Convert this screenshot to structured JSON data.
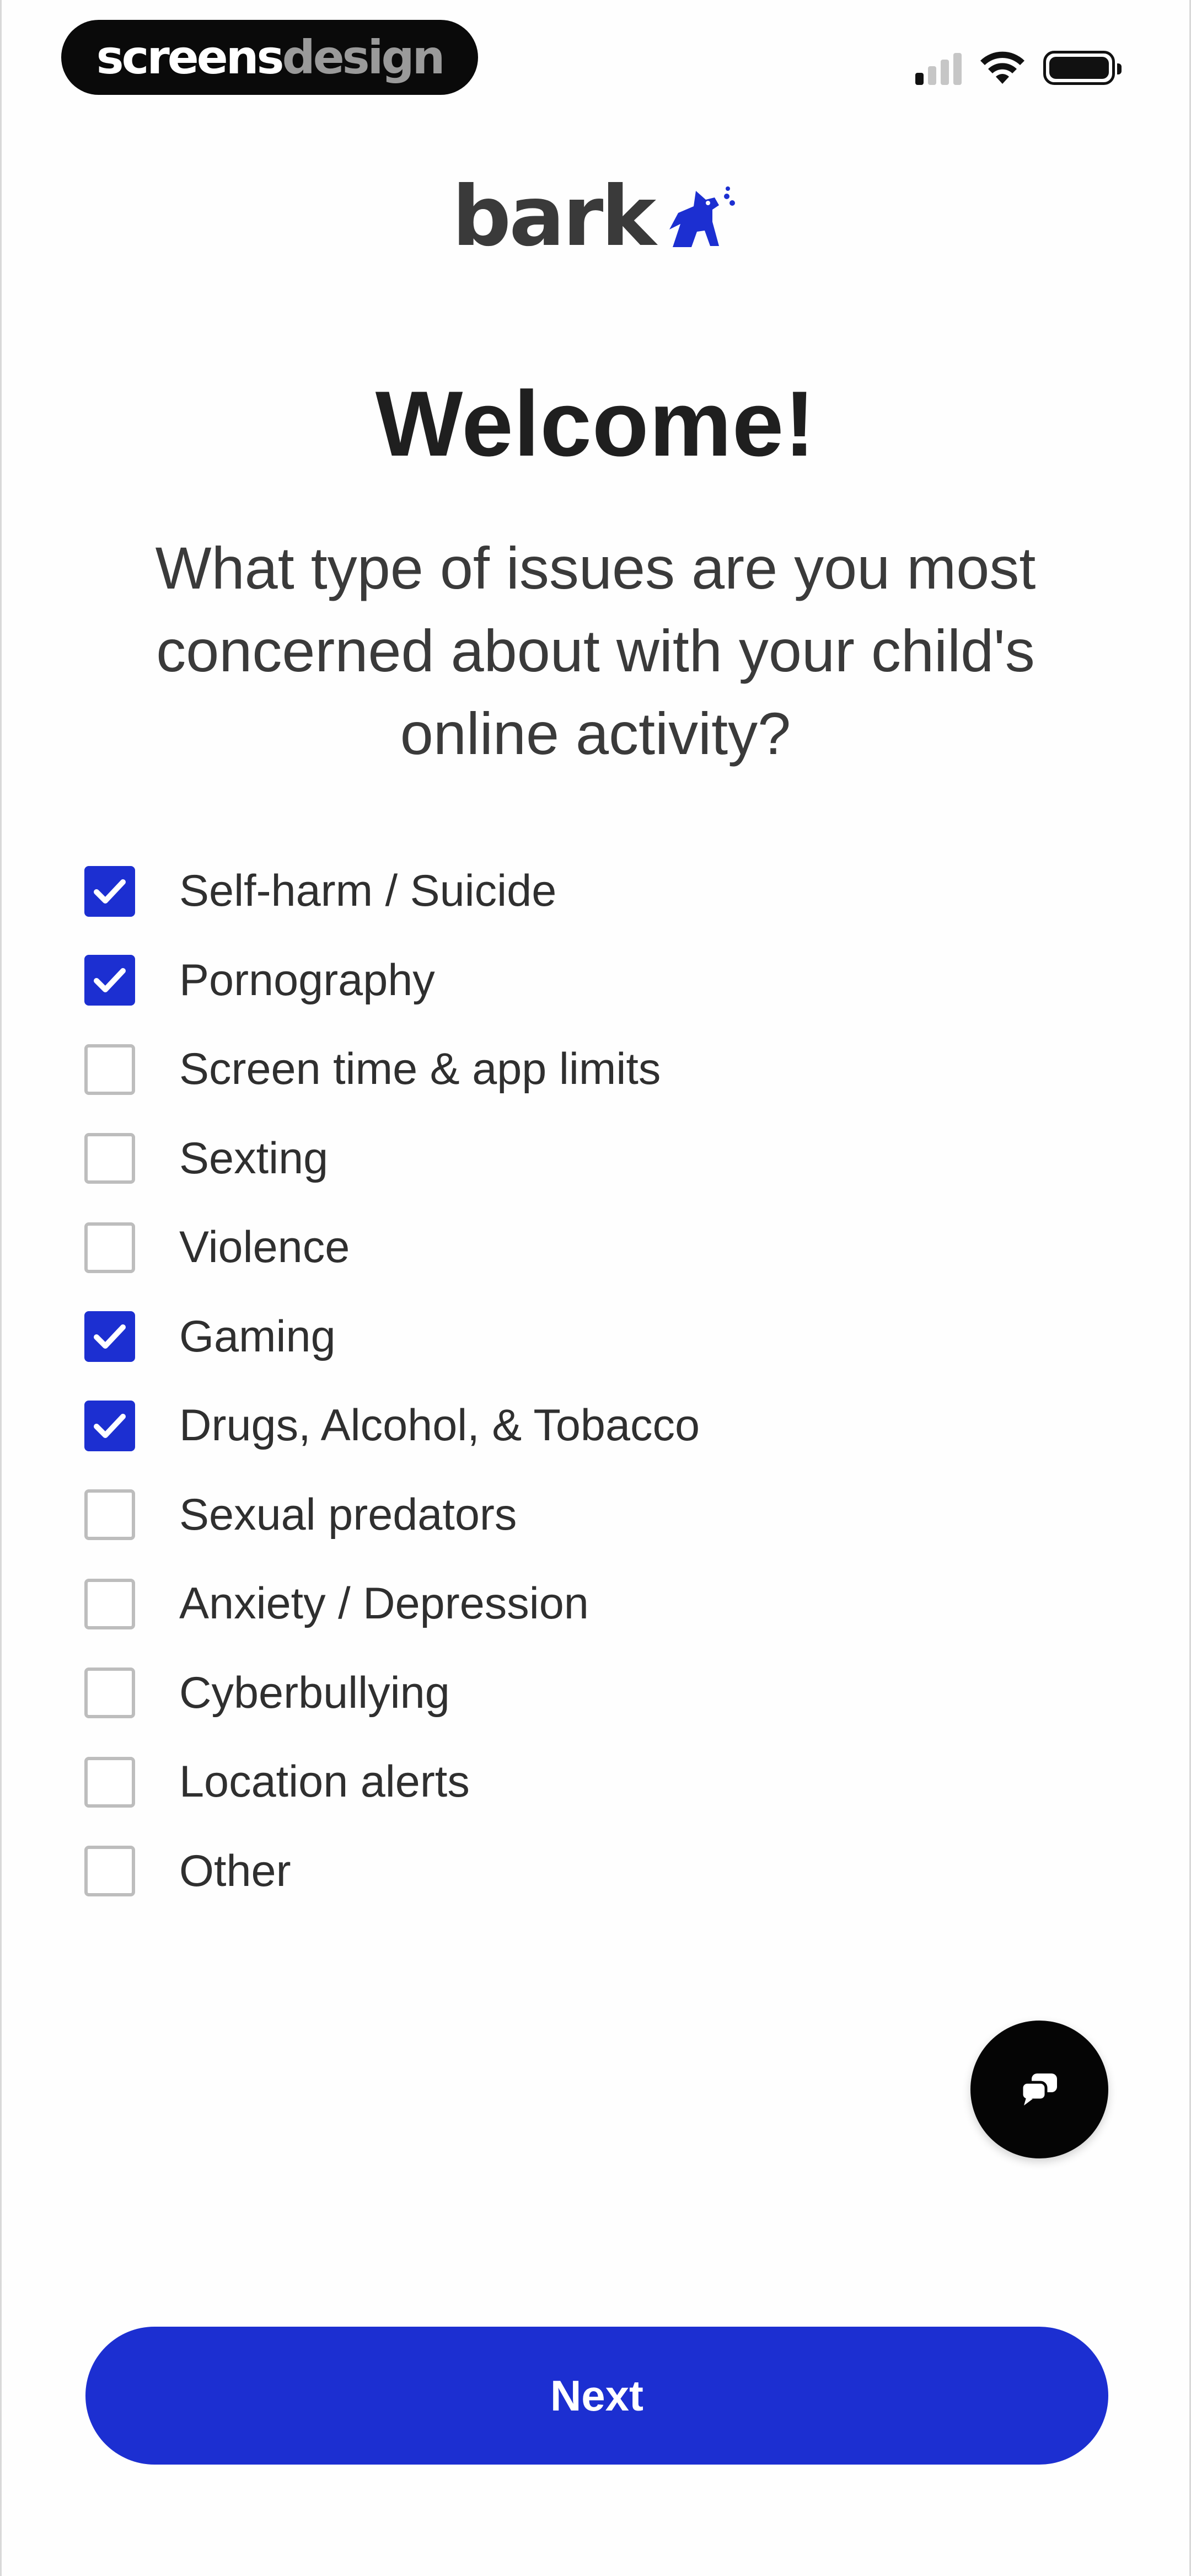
{
  "status_bar": {
    "watermark_part1": "screens",
    "watermark_part2": "design",
    "icons": [
      "signal-icon",
      "wifi-icon",
      "battery-icon"
    ]
  },
  "logo": {
    "text": "bark",
    "mascot_icon": "dog-icon",
    "color": "#1c2fd1"
  },
  "title": "Welcome!",
  "question": "What type of issues are you most concerned about with your child's online activity?",
  "options": [
    {
      "label": "Self-harm / Suicide",
      "checked": true
    },
    {
      "label": "Pornography",
      "checked": true
    },
    {
      "label": "Screen time & app limits",
      "checked": false
    },
    {
      "label": "Sexting",
      "checked": false
    },
    {
      "label": "Violence",
      "checked": false
    },
    {
      "label": "Gaming",
      "checked": true
    },
    {
      "label": "Drugs, Alcohol, & Tobacco",
      "checked": true
    },
    {
      "label": "Sexual predators",
      "checked": false
    },
    {
      "label": "Anxiety / Depression",
      "checked": false
    },
    {
      "label": "Cyberbullying",
      "checked": false
    },
    {
      "label": "Location alerts",
      "checked": false
    },
    {
      "label": "Other",
      "checked": false
    }
  ],
  "chat_button": {
    "icon": "chat-bubbles-icon"
  },
  "next_button": {
    "label": "Next"
  },
  "colors": {
    "accent": "#1c2fd1",
    "fab": "#050505"
  }
}
